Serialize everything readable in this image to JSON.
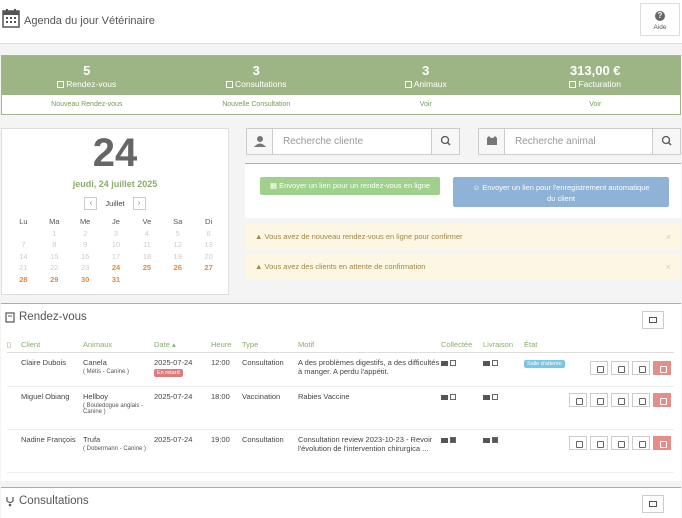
{
  "header": {
    "title": "Agenda du jour Vétérinaire",
    "help_label": "Aide"
  },
  "stats": [
    {
      "value": "5",
      "label": "Rendez-vous",
      "link": "Nouveau Rendez-vous",
      "icon": "book-icon"
    },
    {
      "value": "3",
      "label": "Consultations",
      "link": "Nouvelle Consultation",
      "icon": "stethoscope-icon"
    },
    {
      "value": "3",
      "label": "Animaux",
      "link": "Voir",
      "icon": "paw-icon"
    },
    {
      "value": "313,00 €",
      "label": "Facturation",
      "link": "Voir",
      "icon": "invoice-icon"
    }
  ],
  "calendar": {
    "day": "24",
    "date": "jeudi, 24 juillet 2025",
    "month": "Juillet",
    "prev": "‹",
    "next": "›",
    "weekdays": [
      "Lu",
      "Ma",
      "Me",
      "Je",
      "Ve",
      "Sa",
      "Di"
    ],
    "weeks": [
      [
        "",
        "1",
        "2",
        "3",
        "4",
        "5",
        "6"
      ],
      [
        "7",
        "8",
        "9",
        "10",
        "11",
        "12",
        "13"
      ],
      [
        "14",
        "15",
        "16",
        "17",
        "18",
        "19",
        "20"
      ],
      [
        "21",
        "22",
        "23",
        "24",
        "25",
        "26",
        "27"
      ],
      [
        "28",
        "29",
        "30",
        "31",
        "",
        "",
        ""
      ]
    ]
  },
  "search": {
    "client_placeholder": "Recherche cliente",
    "animal_placeholder": "Recherche animal"
  },
  "links": {
    "rdv_link": "Envoyer un lien pour un rendez-vous en ligne",
    "auto_link_1": "Envoyer un lien pour l'enregistrement automatique",
    "auto_link_2": "du client"
  },
  "alerts": [
    "Vous avez de nouveau rendez-vous en ligne pour confirmer",
    "Vous avez des clients en attente de confirmation"
  ],
  "rdv": {
    "title": "Rendez-vous",
    "columns": [
      "Client",
      "Animaux",
      "Date",
      "Heure",
      "Type",
      "Motif",
      "Collectée",
      "Livraison",
      "État"
    ],
    "rows": [
      {
        "client": "Claire Dubois",
        "animal": "Canela",
        "breed": "( Métis - Canine )",
        "date": "2025-07-24",
        "badge": "En retard",
        "heure": "12:00",
        "type": "Consultation",
        "motif": "A des problèmes digestifs, a des difficultés à manger. A perdu l'appétit.",
        "collectee": false,
        "livraison": false,
        "etat": "Salle d'attente"
      },
      {
        "client": "Miguel Obiang",
        "animal": "Hellboy",
        "breed": "( Bouledogue anglais - Canine )",
        "date": "2025-07-24",
        "badge": "",
        "heure": "18:00",
        "type": "Vaccination",
        "motif": "Rabies Vaccine",
        "collectee": false,
        "livraison": false,
        "etat": ""
      },
      {
        "client": "Nadine François",
        "animal": "Trufa",
        "breed": "( Dobermann - Canine )",
        "date": "2025-07-24",
        "badge": "",
        "heure": "19:00",
        "type": "Consultation",
        "motif": "Consultation review 2023-10-23 - Revoir l'évolution de l'intervention chirurgica ...",
        "collectee": true,
        "livraison": true,
        "etat": ""
      }
    ]
  },
  "consultations": {
    "title": "Consultations"
  }
}
